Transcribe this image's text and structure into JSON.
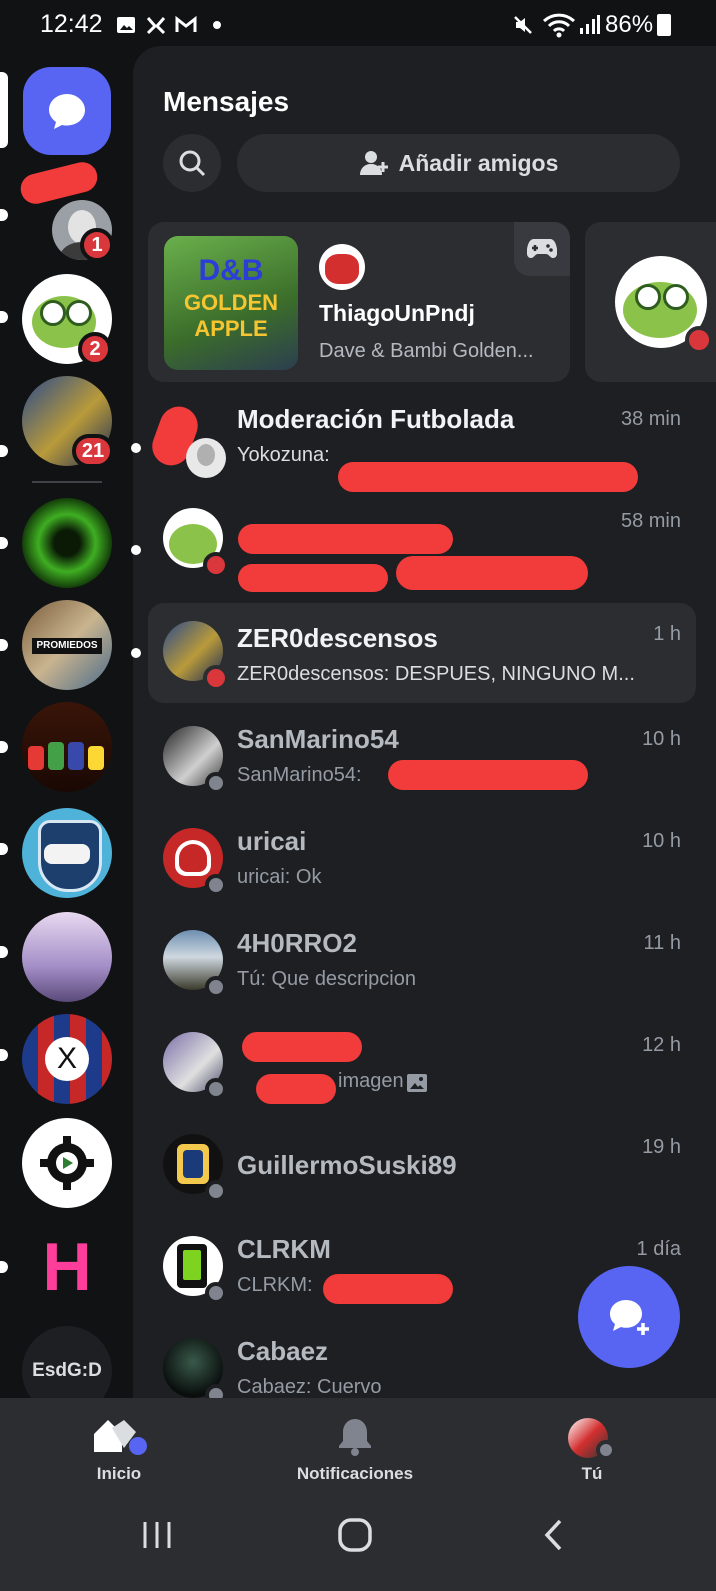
{
  "status_bar": {
    "time": "12:42",
    "battery": "86%"
  },
  "header": {
    "title": "Mensajes",
    "add_friends_label": "Añadir amigos"
  },
  "servers": [
    {
      "name": "direct-messages",
      "badge": null
    },
    {
      "name": "server-1",
      "badge": "1"
    },
    {
      "name": "server-2",
      "badge": "2"
    },
    {
      "name": "server-3",
      "badge": "21"
    },
    {
      "name": "server-4",
      "badge": null
    },
    {
      "name": "server-promiedos",
      "badge": null
    },
    {
      "name": "server-mario",
      "badge": null
    },
    {
      "name": "server-twitter-predio",
      "badge": null
    },
    {
      "name": "server-bandos",
      "badge": null
    },
    {
      "name": "server-x",
      "badge": null
    },
    {
      "name": "server-settings",
      "badge": null
    },
    {
      "name": "server-h",
      "badge": null
    },
    {
      "name": "server-esdg",
      "label": "EsdG:D"
    }
  ],
  "activity_card": {
    "user": "ThiagoUnPndj",
    "game": "Dave & Bambi Golden...",
    "game_art_text": [
      "D&B",
      "GOLDEN",
      "APPLE"
    ]
  },
  "conversations": [
    {
      "name": "Moderación Futbolada",
      "preview": "Yokozuna:",
      "time": "38 min",
      "unread": true
    },
    {
      "name": "",
      "preview": "",
      "time": "58 min",
      "unread": true
    },
    {
      "name": "ZER0descensos",
      "preview": "ZER0descensos: DESPUES, NINGUNO M...",
      "time": "1 h",
      "unread": true
    },
    {
      "name": "SanMarino54",
      "preview": "SanMarino54:",
      "time": "10 h",
      "unread": false
    },
    {
      "name": "uricai",
      "preview": "uricai: Ok",
      "time": "10 h",
      "unread": false
    },
    {
      "name": "4H0RRO2",
      "preview": "Tú: Que descripcion",
      "time": "11 h",
      "unread": false
    },
    {
      "name": "",
      "preview": "imagen",
      "time": "12 h",
      "unread": false
    },
    {
      "name": "GuillermoSuski89",
      "preview": "",
      "time": "19 h",
      "unread": false
    },
    {
      "name": "CLRKM",
      "preview": "CLRKM:",
      "time": "1 día",
      "unread": false
    },
    {
      "name": "Cabaez",
      "preview": "Cabaez: Cuervo",
      "time": "",
      "unread": false
    }
  ],
  "bottom_nav": {
    "home": "Inicio",
    "notifications": "Notificaciones",
    "you": "Tú"
  },
  "colors": {
    "accent": "#5865f2",
    "background": "#1e1f22",
    "rail": "#111214",
    "dnd": "#da373c",
    "badge": "#da373c"
  }
}
